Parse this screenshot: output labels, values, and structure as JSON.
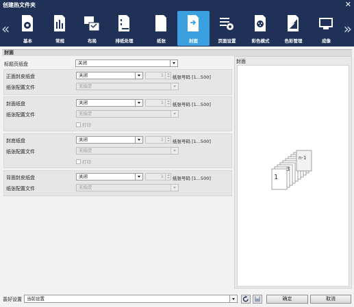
{
  "window": {
    "title": "创建热文件夹",
    "close_label": "✕"
  },
  "toolbar": {
    "nav_prev": "«",
    "nav_next": "»",
    "tabs": [
      {
        "label": "基本",
        "icon": "basic-settings-icon"
      },
      {
        "label": "常规",
        "icon": "general-icon"
      },
      {
        "label": "布局",
        "icon": "layout-icon"
      },
      {
        "label": "排纸处理",
        "icon": "output-finishing-icon"
      },
      {
        "label": "纸张",
        "icon": "paper-icon"
      },
      {
        "label": "封面",
        "icon": "cover-icon",
        "active": true
      },
      {
        "label": "页面设置",
        "icon": "page-settings-icon"
      },
      {
        "label": "彩色模式",
        "icon": "color-mode-icon"
      },
      {
        "label": "色彩管理",
        "icon": "color-management-icon"
      },
      {
        "label": "成像",
        "icon": "imaging-icon"
      }
    ]
  },
  "section": {
    "title": "封面"
  },
  "title_tray": {
    "label": "标题页纸盘",
    "value": "关闭"
  },
  "front_cover": {
    "tray_label": "正面封皮纸盘",
    "tray_value": "关闭",
    "page_value": "1",
    "page_range": "纸张号码 [1...500]",
    "profile_label": "纸张配置文件",
    "profile_value": "无指定"
  },
  "cover": {
    "tray_label": "封面纸盘",
    "tray_value": "关闭",
    "page_value": "1",
    "page_range": "纸张号码 [1...500]",
    "profile_label": "纸张配置文件",
    "profile_value": "无指定",
    "print_label": "打印"
  },
  "back": {
    "tray_label": "封底纸盘",
    "tray_value": "关闭",
    "page_value": "1",
    "page_range": "纸张号码 [1...500]",
    "profile_label": "纸张配置文件",
    "profile_value": "无指定",
    "print_label": "打印"
  },
  "back_cover": {
    "tray_label": "背面封皮纸盘",
    "tray_value": "关闭",
    "page_value": "1",
    "page_range": "纸张号码 [1...500]",
    "profile_label": "纸张配置文件",
    "profile_value": "无指定"
  },
  "preview": {
    "title": "封面",
    "page_first": "1",
    "page_middle": "3",
    "page_last": "n-1"
  },
  "footer": {
    "favorite_label": "喜好设置",
    "favorite_value": "当前设置",
    "refresh_icon": "refresh-icon",
    "save_icon": "save-icon",
    "ok_label": "确定",
    "cancel_label": "取消"
  },
  "colors": {
    "toolbar_bg": "#1f3157",
    "active_tab": "#3aa0e0",
    "panel_bg": "#f2f2f2"
  }
}
